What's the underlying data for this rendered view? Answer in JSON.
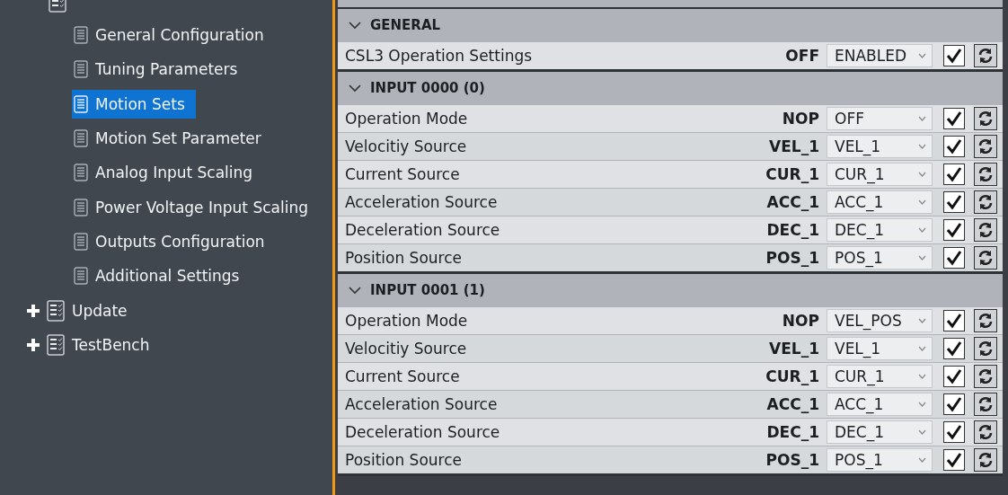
{
  "sidebar": {
    "items": [
      {
        "children": [
          {
            "label": "General Configuration",
            "selected": false
          },
          {
            "label": "Tuning Parameters",
            "selected": false
          },
          {
            "label": "Motion Sets",
            "selected": true
          },
          {
            "label": "Motion Set Parameter",
            "selected": false
          },
          {
            "label": "Analog Input Scaling",
            "selected": false
          },
          {
            "label": "Power Voltage Input Scaling",
            "selected": false
          },
          {
            "label": "Outputs Configuration",
            "selected": false
          },
          {
            "label": "Additional Settings",
            "selected": false
          }
        ]
      },
      {
        "label": "Update",
        "expanded": false
      },
      {
        "label": "TestBench",
        "expanded": false
      }
    ]
  },
  "sections": [
    {
      "title": "GENERAL",
      "expanded": true,
      "rows": [
        {
          "label": "CSL3 Operation Settings",
          "value": "OFF",
          "option": "ENABLED",
          "checked": true
        }
      ]
    },
    {
      "title": "INPUT 0000 (0)",
      "expanded": true,
      "rows": [
        {
          "label": "Operation Mode",
          "value": "NOP",
          "option": "OFF",
          "checked": true
        },
        {
          "label": "Velocitiy Source",
          "value": "VEL_1",
          "option": "VEL_1",
          "checked": true
        },
        {
          "label": "Current Source",
          "value": "CUR_1",
          "option": "CUR_1",
          "checked": true
        },
        {
          "label": "Acceleration Source",
          "value": "ACC_1",
          "option": "ACC_1",
          "checked": true
        },
        {
          "label": "Deceleration Source",
          "value": "DEC_1",
          "option": "DEC_1",
          "checked": true
        },
        {
          "label": "Position Source",
          "value": "POS_1",
          "option": "POS_1",
          "checked": true
        }
      ]
    },
    {
      "title": "INPUT 0001 (1)",
      "expanded": true,
      "rows": [
        {
          "label": "Operation Mode",
          "value": "NOP",
          "option": "VEL_POS",
          "checked": true
        },
        {
          "label": "Velocitiy Source",
          "value": "VEL_1",
          "option": "VEL_1",
          "checked": true
        },
        {
          "label": "Current Source",
          "value": "CUR_1",
          "option": "CUR_1",
          "checked": true
        },
        {
          "label": "Acceleration Source",
          "value": "ACC_1",
          "option": "ACC_1",
          "checked": true
        },
        {
          "label": "Deceleration Source",
          "value": "DEC_1",
          "option": "DEC_1",
          "checked": true
        },
        {
          "label": "Position Source",
          "value": "POS_1",
          "option": "POS_1",
          "checked": true
        }
      ]
    }
  ]
}
